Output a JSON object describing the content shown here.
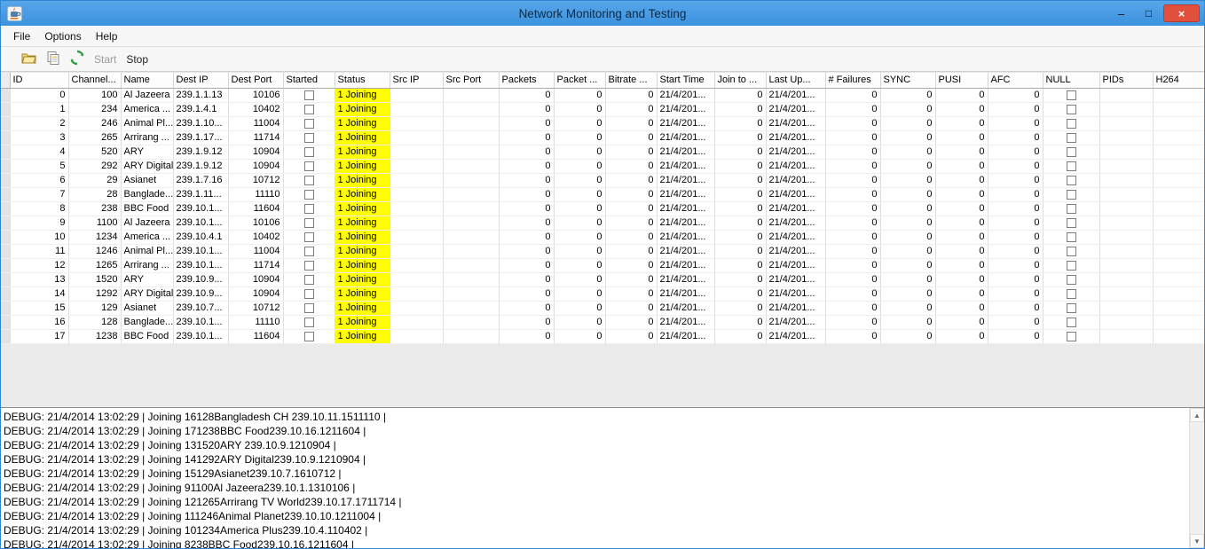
{
  "window": {
    "title": "Network Monitoring and Testing",
    "minimize_glyph": "–",
    "maximize_glyph": "□",
    "close_glyph": "×"
  },
  "menu": {
    "items": [
      "File",
      "Options",
      "Help"
    ]
  },
  "toolbar": {
    "start_label": "Start",
    "stop_label": "Stop",
    "icons": [
      "open-folder-icon",
      "copy-icon",
      "start-gears-icon"
    ]
  },
  "table": {
    "columns": [
      "ID",
      "Channel...",
      "Name",
      "Dest IP",
      "Dest Port",
      "Started",
      "Status",
      "Src IP",
      "Src Port",
      "Packets",
      "Packet ...",
      "Bitrate ...",
      "Start Time",
      "Join to ...",
      "Last Up...",
      "# Failures",
      "SYNC",
      "PUSI",
      "AFC",
      "NULL",
      "PIDs",
      "H264"
    ],
    "row_defaults": {
      "started": false,
      "status": "1 Joining",
      "src_ip": "",
      "src_port": "",
      "packets": 0,
      "packet_errors": 0,
      "bitrate": 0,
      "start_time": "21/4/201...",
      "join_to": 0,
      "last_up": "21/4/201...",
      "failures": 0,
      "sync": 0,
      "pusi": 0,
      "afc": 0,
      "null_flag": false,
      "pids": "",
      "h264": ""
    },
    "rows": [
      {
        "id": 0,
        "channel": 100,
        "name": "Al Jazeera",
        "dest_ip": "239.1.1.13",
        "dest_port": 10106
      },
      {
        "id": 1,
        "channel": 234,
        "name": "America ...",
        "dest_ip": "239.1.4.1",
        "dest_port": 10402
      },
      {
        "id": 2,
        "channel": 246,
        "name": "Animal Pl...",
        "dest_ip": "239.1.10...",
        "dest_port": 11004
      },
      {
        "id": 3,
        "channel": 265,
        "name": "Arrirang ...",
        "dest_ip": "239.1.17...",
        "dest_port": 11714
      },
      {
        "id": 4,
        "channel": 520,
        "name": "ARY",
        "dest_ip": "239.1.9.12",
        "dest_port": 10904
      },
      {
        "id": 5,
        "channel": 292,
        "name": "ARY Digital",
        "dest_ip": "239.1.9.12",
        "dest_port": 10904
      },
      {
        "id": 6,
        "channel": 29,
        "name": "Asianet",
        "dest_ip": "239.1.7.16",
        "dest_port": 10712
      },
      {
        "id": 7,
        "channel": 28,
        "name": "Banglade...",
        "dest_ip": "239.1.11...",
        "dest_port": 11110
      },
      {
        "id": 8,
        "channel": 238,
        "name": "BBC Food",
        "dest_ip": "239.10.1...",
        "dest_port": 11604
      },
      {
        "id": 9,
        "channel": 1100,
        "name": "Al Jazeera",
        "dest_ip": "239.10.1...",
        "dest_port": 10106
      },
      {
        "id": 10,
        "channel": 1234,
        "name": "America ...",
        "dest_ip": "239.10.4.1",
        "dest_port": 10402
      },
      {
        "id": 11,
        "channel": 1246,
        "name": "Animal Pl...",
        "dest_ip": "239.10.1...",
        "dest_port": 11004
      },
      {
        "id": 12,
        "channel": 1265,
        "name": "Arrirang ...",
        "dest_ip": "239.10.1...",
        "dest_port": 11714
      },
      {
        "id": 13,
        "channel": 1520,
        "name": "ARY",
        "dest_ip": "239.10.9...",
        "dest_port": 10904
      },
      {
        "id": 14,
        "channel": 1292,
        "name": "ARY Digital",
        "dest_ip": "239.10.9...",
        "dest_port": 10904
      },
      {
        "id": 15,
        "channel": 129,
        "name": "Asianet",
        "dest_ip": "239.10.7...",
        "dest_port": 10712
      },
      {
        "id": 16,
        "channel": 128,
        "name": "Banglade...",
        "dest_ip": "239.10.1...",
        "dest_port": 11110
      },
      {
        "id": 17,
        "channel": 1238,
        "name": "BBC Food",
        "dest_ip": "239.10.1...",
        "dest_port": 11604
      }
    ]
  },
  "log": {
    "lines": [
      "DEBUG: 21/4/2014 13:02:29 | Joining 16128Bangladesh CH 239.10.11.1511110 |",
      "DEBUG: 21/4/2014 13:02:29 | Joining 171238BBC Food239.10.16.1211604 |",
      "DEBUG: 21/4/2014 13:02:29 | Joining 131520ARY 239.10.9.1210904 |",
      "DEBUG: 21/4/2014 13:02:29 | Joining 141292ARY Digital239.10.9.1210904 |",
      "DEBUG: 21/4/2014 13:02:29 | Joining 15129Asianet239.10.7.1610712 |",
      "DEBUG: 21/4/2014 13:02:29 | Joining 91100Al Jazeera239.10.1.1310106 |",
      "DEBUG: 21/4/2014 13:02:29 | Joining 121265Arrirang TV World239.10.17.1711714 |",
      "DEBUG: 21/4/2014 13:02:29 | Joining 111246Animal Planet239.10.10.1211004 |",
      "DEBUG: 21/4/2014 13:02:29 | Joining 101234America Plus239.10.4.110402 |",
      "DEBUG: 21/4/2014 13:02:29 | Joining 8238BBC Food239.10.16.1211604 |"
    ]
  },
  "colors": {
    "titlebar": "#4196e2",
    "close_button": "#e1503c",
    "status_bg": "#ffff00"
  }
}
